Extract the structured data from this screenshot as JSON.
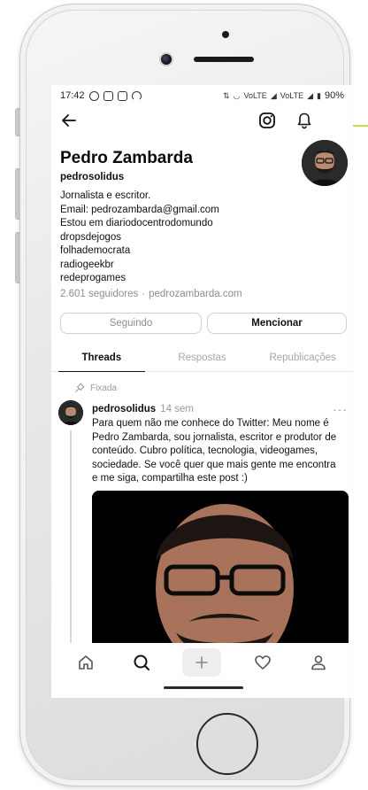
{
  "status_bar": {
    "time": "17:42",
    "battery": "90%",
    "network_label_1": "VoLTE",
    "network_label_2": "VoLTE"
  },
  "profile": {
    "name": "Pedro Zambarda",
    "handle": "pedrosolidus",
    "bio_lines": [
      "Jornalista e escritor.",
      "Email: pedrozambarda@gmail.com",
      "Estou em diariodocentrodomundo",
      "dropsdejogos",
      "folhademocrata",
      "radiogeekbr",
      "redeprogames"
    ],
    "followers": "2.601 seguidores",
    "separator": "·",
    "website": "pedrozambarda.com"
  },
  "buttons": {
    "follow_label": "Seguindo",
    "mention_label": "Mencionar"
  },
  "tabs": [
    {
      "label": "Threads",
      "active": true
    },
    {
      "label": "Respostas",
      "active": false
    },
    {
      "label": "Republicações",
      "active": false
    }
  ],
  "pinned_post": {
    "pinned_label": "Fixada",
    "username": "pedrosolidus",
    "time": "14 sem",
    "more": "···",
    "text_lines": [
      "Para quem não me conhece do Twitter: Meu nome é",
      "Pedro Zambarda, sou jornalista, escritor e produtor de",
      "conteúdo. Cubro política, tecnologia, videogames,",
      "sociedade. Se você quer que mais gente me encontra",
      "e me siga, compartilha este post :)"
    ]
  },
  "icons": {
    "back": "arrow-left-icon",
    "instagram": "instagram-icon",
    "notifications": "bell-icon",
    "pin": "pin-icon",
    "home": "home-icon",
    "search": "search-icon",
    "compose": "plus-icon",
    "activity": "heart-icon",
    "profile": "person-icon"
  },
  "colors": {
    "accent_marker": "#c4dd45",
    "muted_text": "#8e8e8e",
    "primary_text": "#111111"
  }
}
